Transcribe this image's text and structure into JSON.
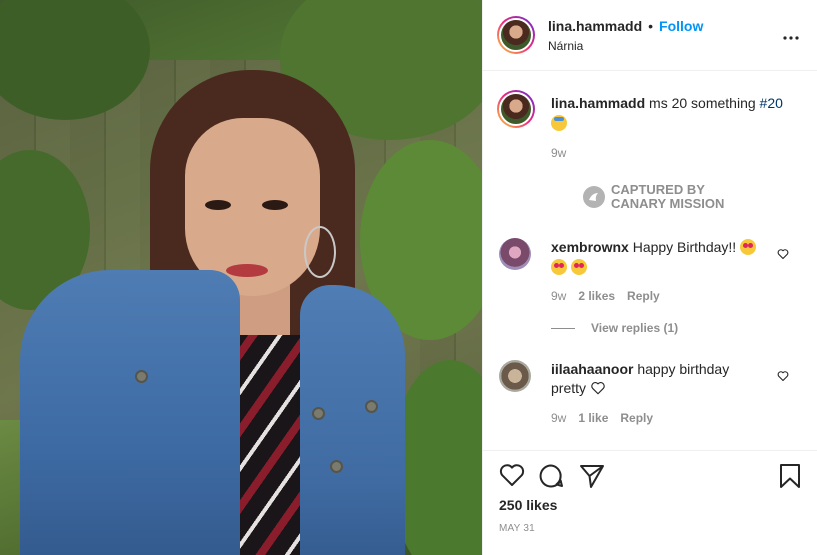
{
  "post": {
    "username": "lina.hammadd",
    "follow_label": "Follow",
    "separator": "•",
    "location": "Nárnia",
    "more_label": "•••"
  },
  "caption": {
    "username": "lina.hammadd",
    "text": "ms 20 something",
    "hashtag": "#20",
    "emoji": "party-face-emoji",
    "time": "9w"
  },
  "watermark": {
    "line1": "CAPTURED BY",
    "line2": "CANARY MISSION"
  },
  "comments": [
    {
      "username": "xembrownx",
      "text": "Happy Birthday!!",
      "emojis": [
        "heart-eyes-emoji",
        "heart-eyes-emoji",
        "heart-eyes-emoji"
      ],
      "time": "9w",
      "likes": "2 likes",
      "reply_label": "Reply",
      "view_replies": "View replies (1)"
    },
    {
      "username": "iilaahaanoor",
      "text": "happy birthday pretty",
      "emojis": [
        "white-heart-emoji"
      ],
      "time": "9w",
      "likes": "1 like",
      "reply_label": "Reply"
    }
  ],
  "footer": {
    "likes": "250 likes",
    "date": "MAY 31"
  },
  "colors": {
    "link_blue": "#0095f6",
    "hashtag_blue": "#00376b",
    "muted_gray": "#8e8e8e",
    "text": "#262626"
  }
}
